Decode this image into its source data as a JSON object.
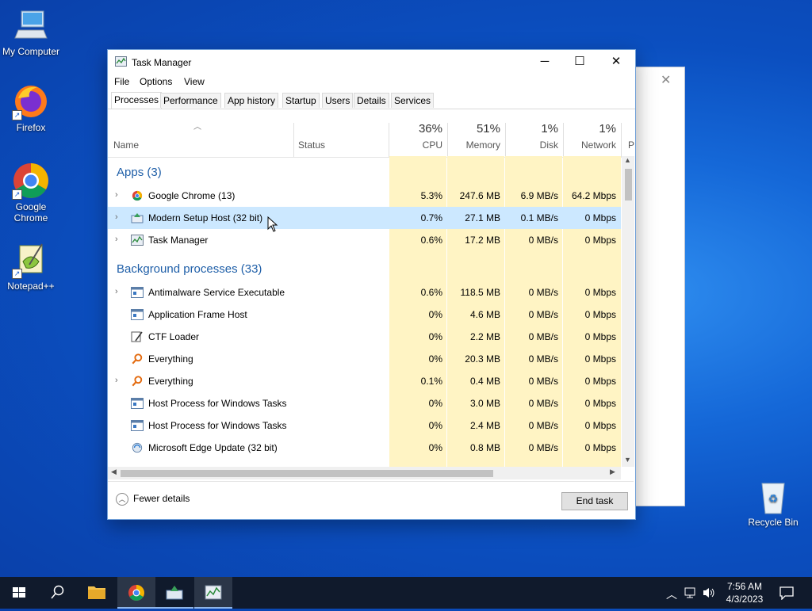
{
  "desktop": {
    "icons": [
      {
        "label": "My Computer"
      },
      {
        "label": "Firefox"
      },
      {
        "label": "Google Chrome"
      },
      {
        "label": "Notepad++"
      },
      {
        "label": "Recycle Bin"
      }
    ]
  },
  "window": {
    "title": "Task Manager",
    "menu": [
      "File",
      "Options",
      "View"
    ],
    "tabs": [
      "Processes",
      "Performance",
      "App history",
      "Startup",
      "Users",
      "Details",
      "Services"
    ],
    "active_tab": "Processes"
  },
  "columns": {
    "name": "Name",
    "status": "Status",
    "cpu": {
      "pct": "36%",
      "label": "CPU"
    },
    "memory": {
      "pct": "51%",
      "label": "Memory"
    },
    "disk": {
      "pct": "1%",
      "label": "Disk"
    },
    "network": {
      "pct": "1%",
      "label": "Network"
    },
    "power_partial": "P"
  },
  "groups": {
    "apps": "Apps (3)",
    "background": "Background processes (33)"
  },
  "apps": [
    {
      "name": "Google Chrome (13)",
      "cpu": "5.3%",
      "memory": "247.6 MB",
      "disk": "6.9 MB/s",
      "network": "64.2 Mbps",
      "expandable": true,
      "icon": "chrome-icon"
    },
    {
      "name": "Modern Setup Host (32 bit)",
      "cpu": "0.7%",
      "memory": "27.1 MB",
      "disk": "0.1 MB/s",
      "network": "0 Mbps",
      "expandable": true,
      "icon": "setup-host-icon",
      "selected": true
    },
    {
      "name": "Task Manager",
      "cpu": "0.6%",
      "memory": "17.2 MB",
      "disk": "0 MB/s",
      "network": "0 Mbps",
      "expandable": true,
      "icon": "task-manager-icon"
    }
  ],
  "background": [
    {
      "name": "Antimalware Service Executable",
      "cpu": "0.6%",
      "memory": "118.5 MB",
      "disk": "0 MB/s",
      "network": "0 Mbps",
      "expandable": true,
      "icon": "service-icon"
    },
    {
      "name": "Application Frame Host",
      "cpu": "0%",
      "memory": "4.6 MB",
      "disk": "0 MB/s",
      "network": "0 Mbps",
      "expandable": false,
      "icon": "service-icon"
    },
    {
      "name": "CTF Loader",
      "cpu": "0%",
      "memory": "2.2 MB",
      "disk": "0 MB/s",
      "network": "0 Mbps",
      "expandable": false,
      "icon": "ctf-icon"
    },
    {
      "name": "Everything",
      "cpu": "0%",
      "memory": "20.3 MB",
      "disk": "0 MB/s",
      "network": "0 Mbps",
      "expandable": false,
      "icon": "everything-icon"
    },
    {
      "name": "Everything",
      "cpu": "0.1%",
      "memory": "0.4 MB",
      "disk": "0 MB/s",
      "network": "0 Mbps",
      "expandable": true,
      "icon": "everything-icon"
    },
    {
      "name": "Host Process for Windows Tasks",
      "cpu": "0%",
      "memory": "3.0 MB",
      "disk": "0 MB/s",
      "network": "0 Mbps",
      "expandable": false,
      "icon": "service-icon"
    },
    {
      "name": "Host Process for Windows Tasks",
      "cpu": "0%",
      "memory": "2.4 MB",
      "disk": "0 MB/s",
      "network": "0 Mbps",
      "expandable": false,
      "icon": "service-icon"
    },
    {
      "name": "Microsoft Edge Update (32 bit)",
      "cpu": "0%",
      "memory": "0.8 MB",
      "disk": "0 MB/s",
      "network": "0 Mbps",
      "expandable": false,
      "icon": "edge-update-icon"
    }
  ],
  "footer": {
    "fewer_details": "Fewer details",
    "end_task": "End task"
  },
  "taskbar": {
    "time": "7:56 AM",
    "date": "4/3/2023"
  },
  "colors": {
    "heat_light": "#fff4c4",
    "heat_medium": "#ffe9a8",
    "selected_row": "#cce8ff",
    "group_text": "#1f5fa8"
  }
}
